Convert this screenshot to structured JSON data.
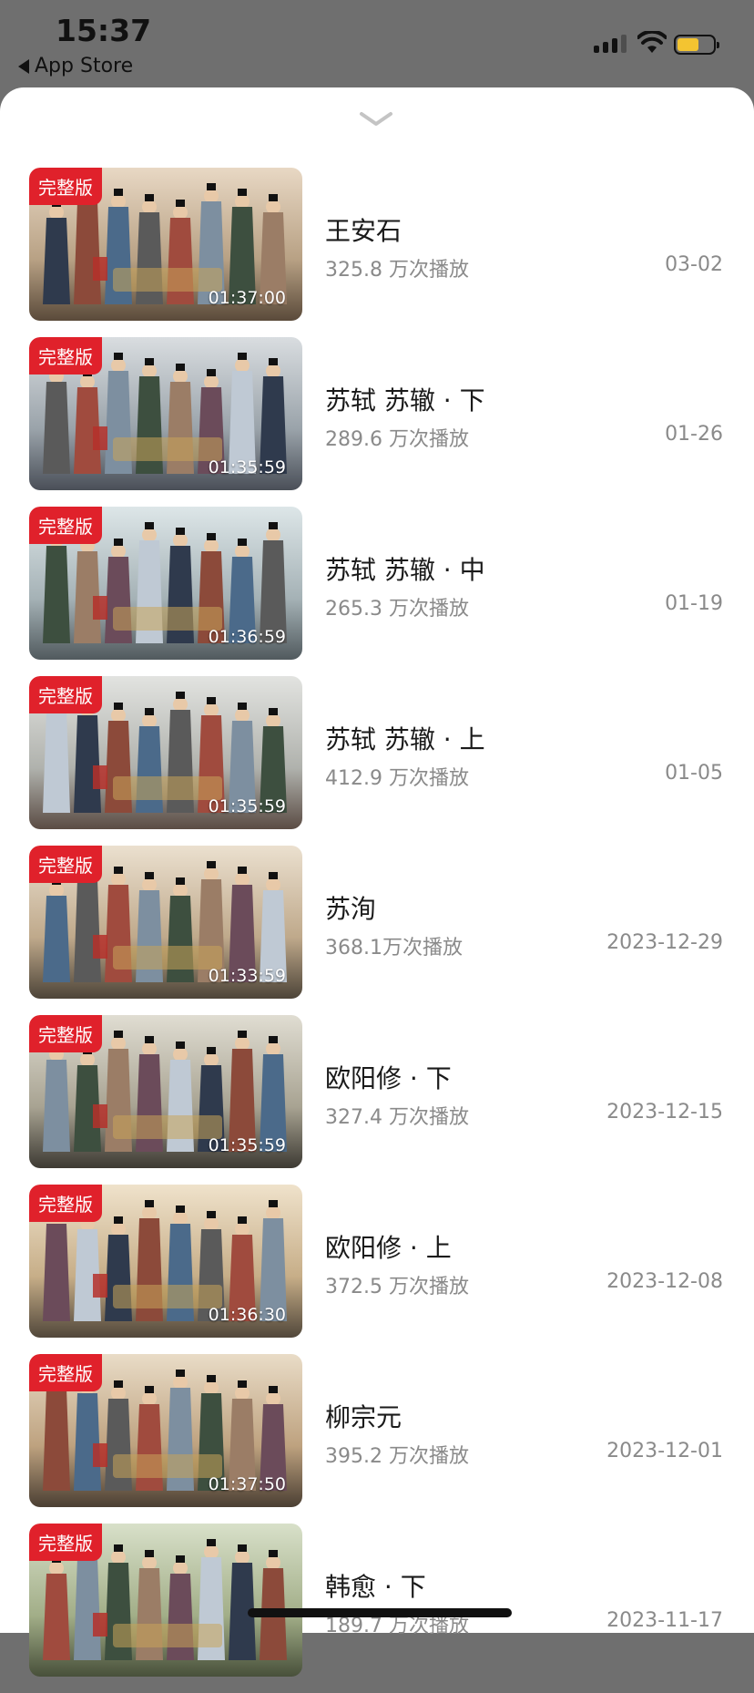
{
  "status_bar": {
    "time": "15:37",
    "back_label": "App Store"
  },
  "colors": {
    "badge": "#e0212b",
    "battery": "#f3c431"
  },
  "badge_label": "完整版",
  "episodes": [
    {
      "title": "王安石",
      "plays": "325.8 万次播放",
      "date": "03-02",
      "duration": "01:37:00"
    },
    {
      "title": "苏轼 苏辙 · 下",
      "plays": "289.6 万次播放",
      "date": "01-26",
      "duration": "01:35:59"
    },
    {
      "title": "苏轼 苏辙 · 中",
      "plays": "265.3 万次播放",
      "date": "01-19",
      "duration": "01:36:59"
    },
    {
      "title": "苏轼 苏辙 · 上",
      "plays": "412.9 万次播放",
      "date": "01-05",
      "duration": "01:35:59"
    },
    {
      "title": "苏洵",
      "plays": "368.1万次播放",
      "date": "2023-12-29",
      "duration": "01:33:59"
    },
    {
      "title": "欧阳修 · 下",
      "plays": "327.4 万次播放",
      "date": "2023-12-15",
      "duration": "01:35:59"
    },
    {
      "title": "欧阳修 · 上",
      "plays": "372.5 万次播放",
      "date": "2023-12-08",
      "duration": "01:36:30"
    },
    {
      "title": "柳宗元",
      "plays": "395.2 万次播放",
      "date": "2023-12-01",
      "duration": "01:37:50"
    },
    {
      "title": "韩愈 · 下",
      "plays": "189.7 万次播放",
      "date": "2023-11-17",
      "duration": ""
    }
  ]
}
